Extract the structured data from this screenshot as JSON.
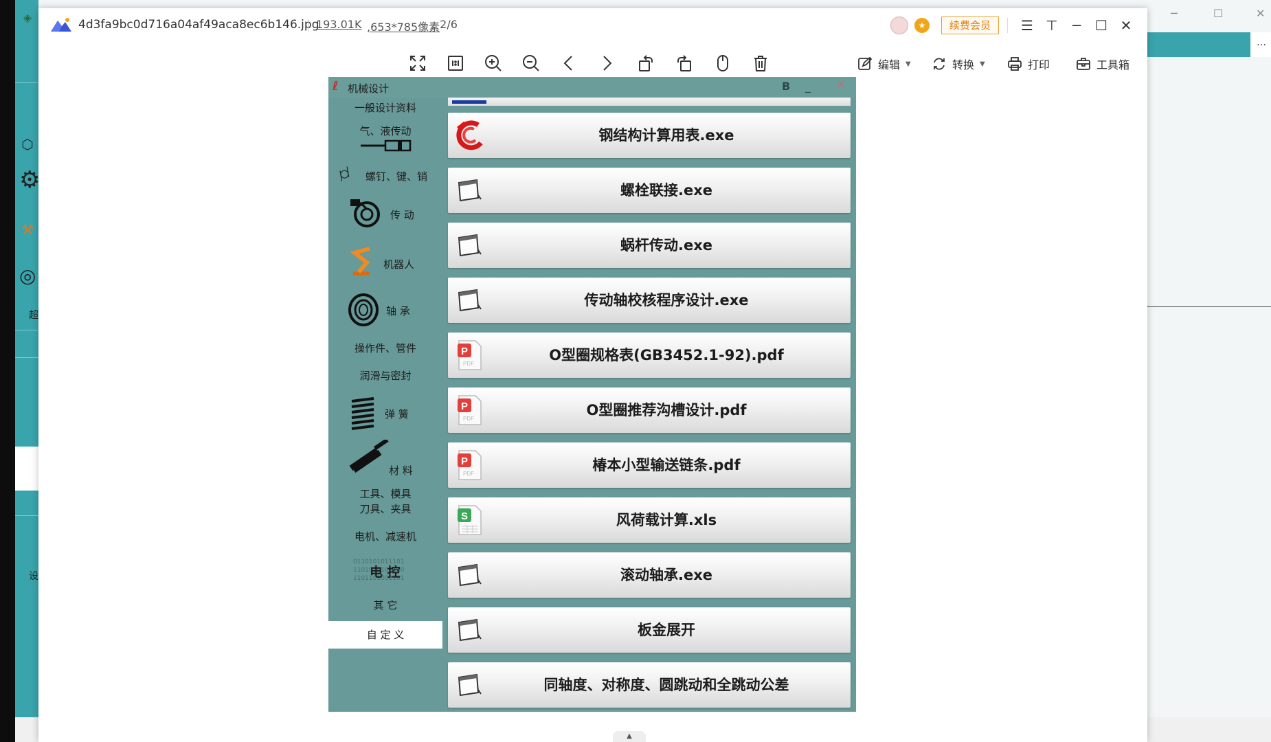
{
  "viewer": {
    "file_name": "4d3fa9bc0d716a04af49aca8ec6b146.jpg",
    "file_size": "193.01K",
    "file_dims": ",653*785像素",
    "file_index": ", 2/6",
    "vip_label": "续费会员",
    "icons": {
      "menu": "menu-icon",
      "pin": "pin-icon",
      "minimize": "minimize-icon",
      "maximize": "maximize-icon",
      "close": "close-icon"
    }
  },
  "toolbar": {
    "tools": [
      "fullscreen-icon",
      "actual-size-icon",
      "zoom-in-icon",
      "zoom-out-icon",
      "previous-icon",
      "next-icon",
      "rotate-left-icon",
      "rotate-right-icon",
      "mouse-icon",
      "delete-icon"
    ],
    "edit_label": "编辑",
    "convert_label": "转换",
    "print_label": "打印",
    "toolbox_label": "工具箱"
  },
  "app": {
    "title": "机械设计",
    "title_b": "B",
    "nav": [
      {
        "label": "一般设计资料",
        "icon": ""
      },
      {
        "label": "气、液传动",
        "icon": "cylinder-icon"
      },
      {
        "label": "螺钉、键、销",
        "icon": "bolt-icon"
      },
      {
        "label": "传 动",
        "icon": "gear-transmission-icon"
      },
      {
        "label": "机器人",
        "icon": "robot-arm-icon"
      },
      {
        "label": "轴 承",
        "icon": "bearing-icon"
      },
      {
        "label": "操作件、管件",
        "icon": ""
      },
      {
        "label": "润滑与密封",
        "icon": ""
      },
      {
        "label": "弹 簧",
        "icon": "spring-icon"
      },
      {
        "label": "材 料",
        "icon": "i-beam-icon"
      },
      {
        "label": "工具、模具",
        "icon": ""
      },
      {
        "label": "刀具、夹具",
        "icon": ""
      },
      {
        "label": "电机、减速机",
        "icon": ""
      },
      {
        "label": "电 控",
        "icon": "binary-icon"
      },
      {
        "label": "其 它",
        "icon": ""
      },
      {
        "label": "自 定 义",
        "icon": ""
      }
    ],
    "programs": [
      {
        "label": "钢结构计算用表.exe",
        "icon": "swirl-app-icon"
      },
      {
        "label": "螺栓联接.exe",
        "icon": "window-app-icon"
      },
      {
        "label": "蜗杆传动.exe",
        "icon": "window-app-icon"
      },
      {
        "label": "传动轴校核程序设计.exe",
        "icon": "window-app-icon"
      },
      {
        "label": "O型圈规格表(GB3452.1-92).pdf",
        "icon": "pdf-file-icon"
      },
      {
        "label": "O型圈推荐沟槽设计.pdf",
        "icon": "pdf-file-icon"
      },
      {
        "label": "椿本小型输送链条.pdf",
        "icon": "pdf-file-icon"
      },
      {
        "label": "风荷载计算.xls",
        "icon": "spreadsheet-file-icon"
      },
      {
        "label": "滚动轴承.exe",
        "icon": "window-app-icon"
      },
      {
        "label": "板金展开",
        "icon": "window-app-icon"
      },
      {
        "label": "同轴度、对称度、圆跳动和全跳动公差",
        "icon": "window-app-icon"
      }
    ]
  },
  "background": {
    "sidebar_text_1": "超",
    "sidebar_text_2": "设"
  }
}
